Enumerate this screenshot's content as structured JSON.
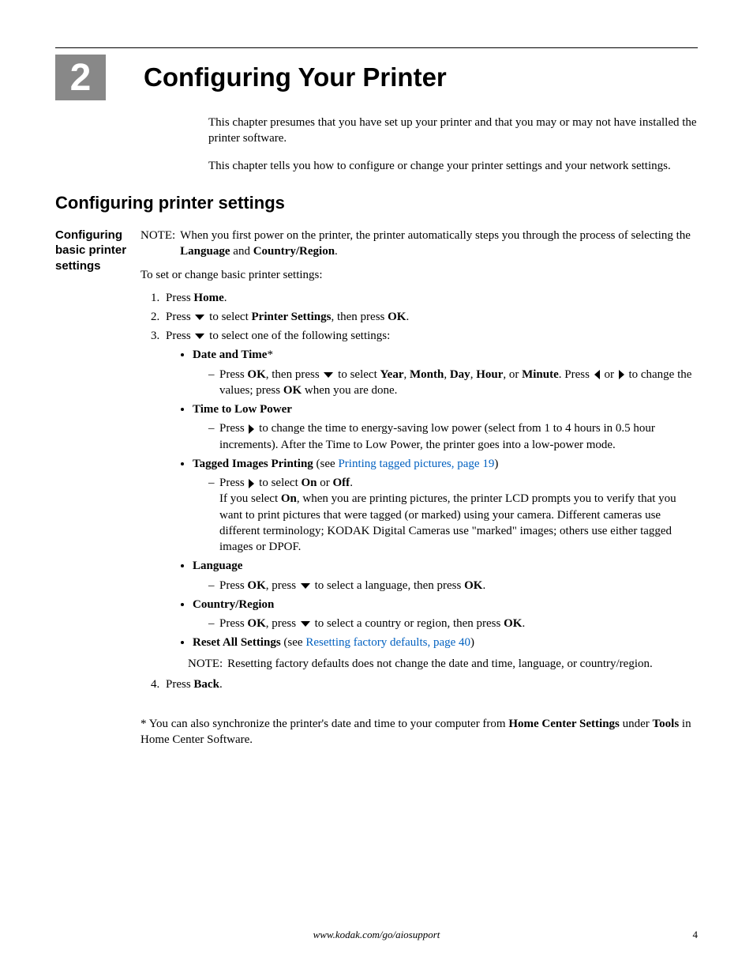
{
  "chapter": {
    "number": "2",
    "title": "Configuring Your Printer"
  },
  "intro": {
    "p1": "This chapter presumes that you have set up your printer and that you may or may not have installed the printer software.",
    "p2": "This chapter tells you how to configure or change your printer settings and your network settings."
  },
  "section_heading": "Configuring printer settings",
  "sidehead": "Configuring basic printer settings",
  "note1": {
    "label": "NOTE:",
    "pre": "When you first power on the printer, the printer automatically steps you through the process of selecting the ",
    "b1": "Language",
    "mid": " and ",
    "b2": "Country/Region",
    "post": "."
  },
  "lead": "To set or change basic printer settings:",
  "steps": {
    "s1": {
      "pre": "Press ",
      "b": "Home",
      "post": "."
    },
    "s2": {
      "pre": "Press ",
      "mid": " to select ",
      "b1": "Printer Settings",
      "post1": ", then press ",
      "b2": "OK",
      "post2": "."
    },
    "s3": {
      "pre": "Press ",
      "post": " to select one of the following settings:"
    },
    "s4": {
      "pre": "Press ",
      "b": "Back",
      "post": "."
    }
  },
  "items": {
    "datetime": {
      "title": "Date and Time",
      "star": "*",
      "d_pre": "Press ",
      "d_b1": "OK",
      "d_mid1": ", then press ",
      "d_mid2": " to select ",
      "d_b2": "Year",
      "d_c1": ", ",
      "d_b3": "Month",
      "d_c2": ", ",
      "d_b4": "Day",
      "d_c3": ", ",
      "d_b5": "Hour",
      "d_c4": ", or ",
      "d_b6": "Minute",
      "d_post1": ". Press ",
      "d_mid3": " or ",
      "d_mid4": " to change the values; press ",
      "d_b7": "OK",
      "d_post2": " when you are done."
    },
    "lowpower": {
      "title": "Time to Low Power",
      "d_pre": "Press ",
      "d_post": " to change the time to energy-saving low power (select from 1 to 4 hours in 0.5 hour increments). After the Time to Low Power, the printer goes into a low-power mode."
    },
    "tagged": {
      "title": "Tagged Images Printing",
      "see_pre": " (see ",
      "link": "Printing tagged pictures, page 19",
      "see_post": ")",
      "d_pre": "Press ",
      "d_mid": " to select ",
      "d_b1": "On",
      "d_or": " or ",
      "d_b2": "Off",
      "d_post1": ".",
      "d2_pre": "If you select ",
      "d2_b": "On",
      "d2_post": ", when you are printing pictures, the printer LCD prompts you to verify that you want to print pictures that were tagged (or marked) using your camera. Different cameras use different terminology; KODAK Digital Cameras use \"marked\" images; others use either tagged images or DPOF."
    },
    "language": {
      "title": "Language",
      "d_pre": "Press ",
      "d_b1": "OK",
      "d_mid1": ", press ",
      "d_mid2": " to select a language, then press ",
      "d_b2": "OK",
      "d_post": "."
    },
    "country": {
      "title": "Country/Region",
      "d_pre": "Press ",
      "d_b1": "OK",
      "d_mid1": ", press ",
      "d_mid2": " to select a country or region, then press ",
      "d_b2": "OK",
      "d_post": "."
    },
    "reset": {
      "title": "Reset All Settings",
      "see_pre": " (see ",
      "link": "Resetting factory defaults, page 40",
      "see_post": ")"
    }
  },
  "note2": {
    "label": "NOTE:",
    "text": "Resetting factory defaults does not change the date and time, language, or country/region."
  },
  "footnote": {
    "star": "*",
    "pre": " You can also synchronize the printer's date and time to your computer from ",
    "b1": "Home Center Settings",
    "mid": " under ",
    "b2": "Tools",
    "post": " in Home Center Software."
  },
  "footer": {
    "url": "www.kodak.com/go/aiosupport",
    "page": "4"
  }
}
